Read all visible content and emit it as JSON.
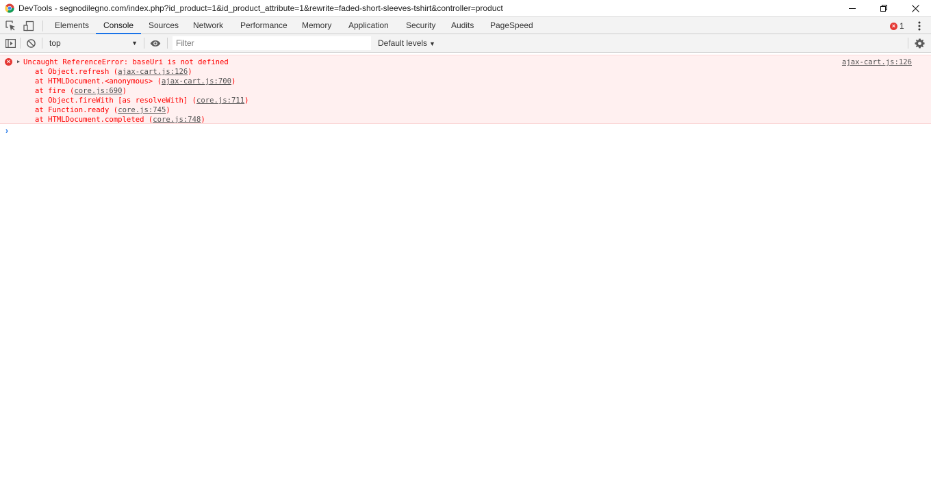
{
  "window": {
    "title": "DevTools - segnodilegno.com/index.php?id_product=1&id_product_attribute=1&rewrite=faded-short-sleeves-tshirt&controller=product"
  },
  "tabs": [
    {
      "label": "Elements",
      "active": false
    },
    {
      "label": "Console",
      "active": true
    },
    {
      "label": "Sources",
      "active": false
    },
    {
      "label": "Network",
      "active": false
    },
    {
      "label": "Performance",
      "active": false
    },
    {
      "label": "Memory",
      "active": false
    },
    {
      "label": "Application",
      "active": false
    },
    {
      "label": "Security",
      "active": false
    },
    {
      "label": "Audits",
      "active": false
    },
    {
      "label": "PageSpeed",
      "active": false
    }
  ],
  "error_badge": {
    "icon": "×",
    "count": "1"
  },
  "console_toolbar": {
    "context": "top",
    "filter_placeholder": "Filter",
    "filter_value": "",
    "levels": "Default levels"
  },
  "error": {
    "message": "Uncaught ReferenceError: baseUri is not defined",
    "source": "ajax-cart.js:126",
    "frames": [
      {
        "prefix": "at Object.refresh (",
        "link": "ajax-cart.js:126",
        "suffix": ")"
      },
      {
        "prefix": "at HTMLDocument.<anonymous> (",
        "link": "ajax-cart.js:700",
        "suffix": ")"
      },
      {
        "prefix": "at fire (",
        "link": "core.js:690",
        "suffix": ")"
      },
      {
        "prefix": "at Object.fireWith [as resolveWith] (",
        "link": "core.js:711",
        "suffix": ")"
      },
      {
        "prefix": "at Function.ready (",
        "link": "core.js:745",
        "suffix": ")"
      },
      {
        "prefix": "at HTMLDocument.completed (",
        "link": "core.js:748",
        "suffix": ")"
      }
    ]
  },
  "prompt_symbol": "›",
  "colors": {
    "accent": "#1a73e8",
    "error_text": "#ff0000",
    "error_bg": "#fff0f0",
    "error_icon": "#e53935"
  }
}
